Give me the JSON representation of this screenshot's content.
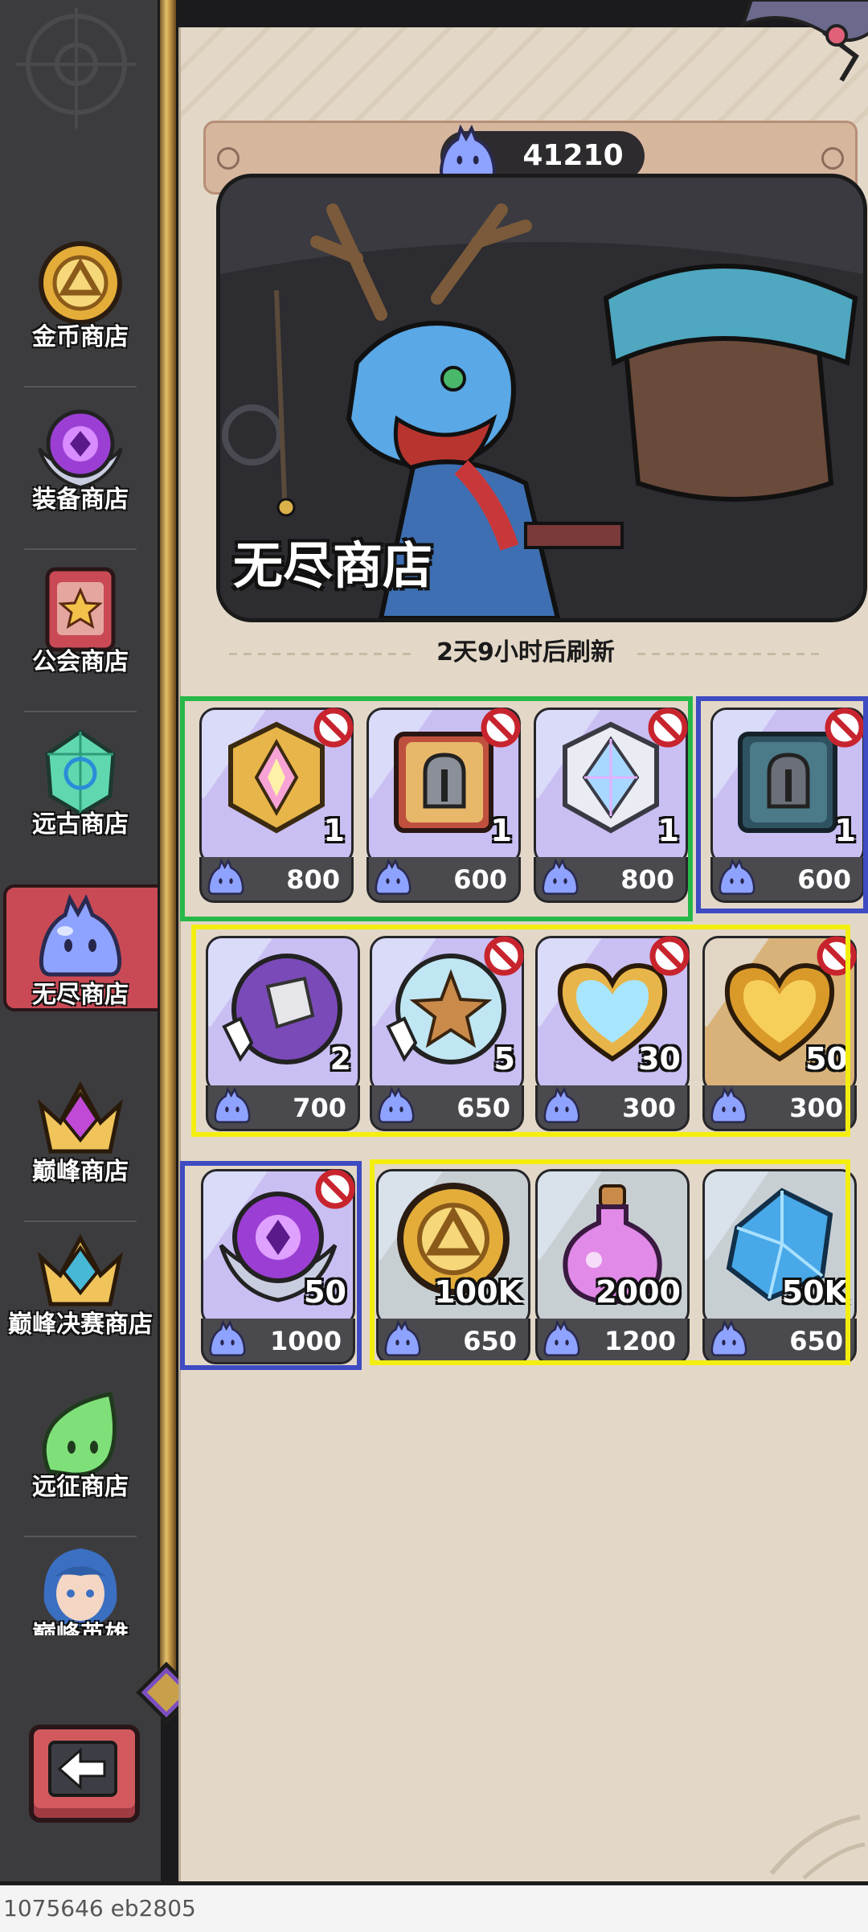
{
  "sidebar": {
    "items": [
      {
        "label": "金币商店",
        "icon": "gold-coin-icon"
      },
      {
        "label": "装备商店",
        "icon": "equipment-orb-icon"
      },
      {
        "label": "公会商店",
        "icon": "guild-banner-icon"
      },
      {
        "label": "远古商店",
        "icon": "ancient-crystal-icon"
      },
      {
        "label": "无尽商店",
        "icon": "slime-icon",
        "active": true
      },
      {
        "label": "巅峰商店",
        "icon": "peak-crown-icon"
      },
      {
        "label": "巅峰决赛商店",
        "icon": "peak-finals-crown-icon"
      },
      {
        "label": "远征商店",
        "icon": "expedition-slime-icon"
      },
      {
        "label": "巅峰英雄",
        "icon": "hero-portrait-icon"
      }
    ],
    "back_icon": "back-arrow-icon"
  },
  "currency": {
    "value": "41210",
    "icon": "slime-currency-icon"
  },
  "banner": {
    "title": "无尽商店"
  },
  "refresh": {
    "text": "2天9小时后刷新"
  },
  "items": [
    {
      "qty": "1",
      "price": "800",
      "icon": "gold-gem-rune-icon",
      "locked": true,
      "bg": "purple"
    },
    {
      "qty": "1",
      "price": "600",
      "icon": "helmet-book-icon",
      "locked": true,
      "bg": "purple"
    },
    {
      "qty": "1",
      "price": "800",
      "icon": "silver-crystal-icon",
      "locked": true,
      "bg": "purple"
    },
    {
      "qty": "1",
      "price": "600",
      "icon": "dark-helmet-book-icon",
      "locked": true,
      "bg": "purple"
    },
    {
      "qty": "2",
      "price": "700",
      "icon": "gauntlet-select-orb-icon",
      "locked": false,
      "bg": "purple"
    },
    {
      "qty": "5",
      "price": "650",
      "icon": "star-select-orb-icon",
      "locked": true,
      "bg": "purple"
    },
    {
      "qty": "30",
      "price": "300",
      "icon": "crystal-heart-icon",
      "locked": true,
      "bg": "purple"
    },
    {
      "qty": "50",
      "price": "300",
      "icon": "gold-heart-icon",
      "locked": true,
      "bg": "gold"
    },
    {
      "qty": "50",
      "price": "1000",
      "icon": "purple-amulet-icon",
      "locked": true,
      "bg": "purple"
    },
    {
      "qty": "100K",
      "price": "650",
      "icon": "gold-coin-icon",
      "locked": false,
      "bg": "grey"
    },
    {
      "qty": "2000",
      "price": "1200",
      "icon": "purple-potion-icon",
      "locked": false,
      "bg": "grey"
    },
    {
      "qty": "50K",
      "price": "650",
      "icon": "blue-crystal-icon",
      "locked": false,
      "bg": "grey"
    }
  ],
  "footer": {
    "text": "1075646 eb2805"
  },
  "colors": {
    "green_box": "#27b84a",
    "blue_box": "#3e4bc2",
    "yellow_box": "#f4ee10"
  }
}
